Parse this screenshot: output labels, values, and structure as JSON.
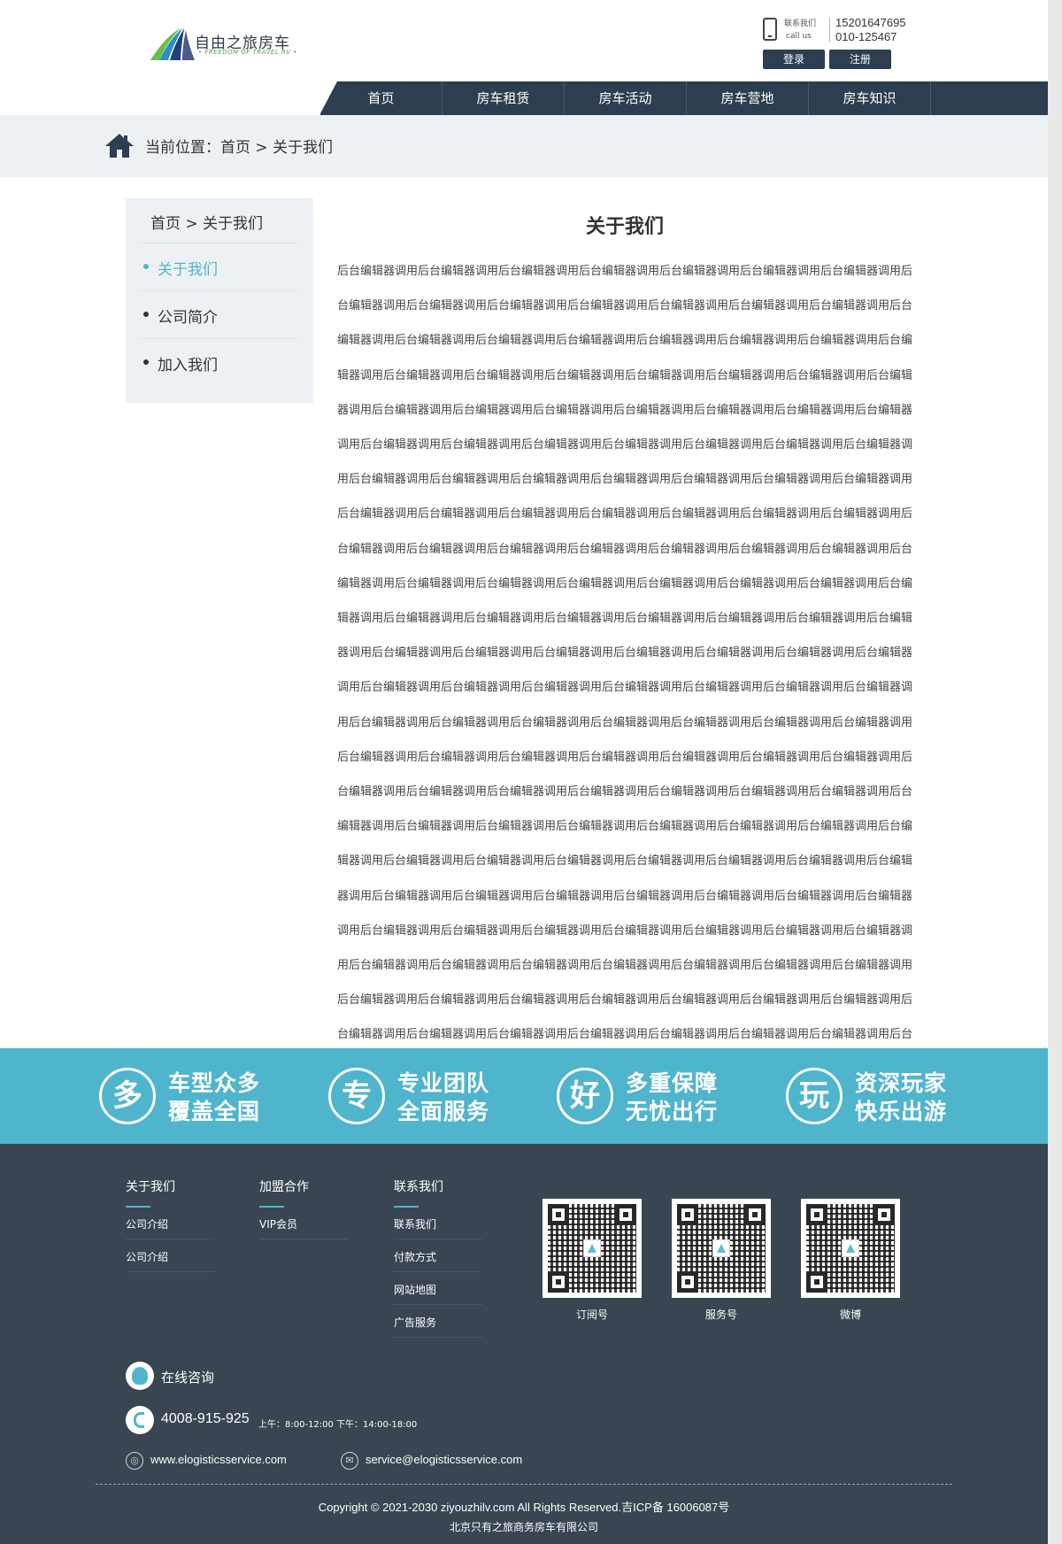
{
  "header": {
    "logo_title": "自由之旅房车",
    "logo_subtitle": "• FREEDOM OF TRAVEL RV •",
    "contact_label_cn": "联系我们",
    "contact_label_en": "call us",
    "phone_1": "15201647695",
    "phone_2": "010-125467",
    "login_label": "登录",
    "register_label": "注册"
  },
  "nav": {
    "items": [
      {
        "label": "首页"
      },
      {
        "label": "房车租赁"
      },
      {
        "label": "房车活动"
      },
      {
        "label": "房车营地"
      },
      {
        "label": "房车知识"
      }
    ]
  },
  "breadcrumb": {
    "text": "当前位置：首页 > 关于我们"
  },
  "sidebar": {
    "title": "首页 > 关于我们",
    "items": [
      {
        "label": "关于我们",
        "active": true
      },
      {
        "label": "公司简介",
        "active": false
      },
      {
        "label": "加入我们",
        "active": false
      }
    ]
  },
  "article": {
    "title": "关于我们",
    "body": "后台编辑器调用后台编辑器调用后台编辑器调用后台编辑器调用后台编辑器调用后台编辑器调用后台编辑器调用后台编辑器调用后台编辑器调用后台编辑器调用后台编辑器调用后台编辑器调用后台编辑器调用后台编辑器调用后台编辑器调用后台编辑器调用后台编辑器调用后台编辑器调用后台编辑器调用后台编辑器调用后台编辑器调用后台编辑器调用后台编辑器调用后台编辑器调用后台编辑器调用后台编辑器调用后台编辑器调用后台编辑器调用后台编辑器调用后台编辑器调用后台编辑器调用后台编辑器调用后台编辑器调用后台编辑器调用后台编辑器调用后台编辑器调用后台编辑器调用后台编辑器调用后台编辑器调用后台编辑器调用后台编辑器调用后台编辑器调用后台编辑器调用后台编辑器调用后台编辑器调用后台编辑器调用后台编辑器调用后台编辑器调用后台编辑器调用后台编辑器调用后台编辑器调用后台编辑器调用后台编辑器调用后台编辑器调用后台编辑器调用后台编辑器调用后台编辑器调用后台编辑器调用后台编辑器调用后台编辑器调用后台编辑器调用后台编辑器调用后台编辑器调用后台编辑器调用后台编辑器调用后台编辑器调用后台编辑器调用后台编辑器调用后台编辑器调用后台编辑器调用后台编辑器调用后台编辑器调用后台编辑器调用后台编辑器调用后台编辑器调用后台编辑器调用后台编辑器调用后台编辑器调用后台编辑器调用后台编辑器调用后台编辑器调用后台编辑器调用后台编辑器调用后台编辑器调用后台编辑器调用后台编辑器调用后台编辑器调用后台编辑器调用后台编辑器调用后台编辑器调用后台编辑器调用后台编辑器调用后台编辑器调用后台编辑器调用后台编辑器调用后台编辑器调用后台编辑器调用后台编辑器调用后台编辑器调用后台编辑器调用后台编辑器调用后台编辑器调用后台编辑器调用后台编辑器调用后台编辑器调用后台编辑器调用后台编辑器调用后台编辑器调用后台编辑器调用后台编辑器调用后台编辑器调用后台编辑器调用后台编辑器调用后台编辑器调用后台编辑器调用后台编辑器调用后台编辑器调用后台编辑器调用后台编辑器调用后台编辑器调用后台编辑器调用后台编辑器调用后台编辑器调用后台编辑器调用后台编辑器调用后台编辑器调用后台编辑器调用后台编辑器调用后台编辑器调用后台编辑器调用后台编辑器调用后台编辑器调用后台编辑器调用后台编辑器调用后台编辑器调用后台编辑器调用后台编辑器调用后台编辑器调用后台编辑器调用后台编辑器调用后台编辑器调用后台编辑器调用后台编辑器调用后台编辑器调用后台编辑器调用后台编辑器调用后台编辑器调用后台编辑器调用后台编辑器调用后台编辑器调用后台编辑器调用后台编辑器调用后台编辑器调用后台编辑器调用后台编辑器调用后台编辑器调用后台编辑器调用后台编辑器调用后台编辑器调用后台编辑器调用后台编辑器调用后台编辑器调用后台编辑器调用后台编辑器调用后台编辑器调用后台编辑器调用后台编辑器调用后台编辑器调用后台编辑器调用"
  },
  "features": [
    {
      "glyph": "多",
      "line1": "车型众多",
      "line2": "覆盖全国"
    },
    {
      "glyph": "专",
      "line1": "专业团队",
      "line2": "全面服务"
    },
    {
      "glyph": "好",
      "line1": "多重保障",
      "line2": "无忧出行"
    },
    {
      "glyph": "玩",
      "line1": "资深玩家",
      "line2": "快乐出游"
    }
  ],
  "footer": {
    "columns": [
      {
        "title": "关于我们",
        "links": [
          "公司介绍",
          "公司介绍"
        ]
      },
      {
        "title": "加盟合作",
        "links": [
          "VIP会员"
        ]
      },
      {
        "title": "联系我们",
        "links": [
          "联系我们",
          "付款方式",
          "网站地图",
          "广告服务"
        ]
      }
    ],
    "qr_codes": [
      {
        "label": "订阅号"
      },
      {
        "label": "服务号"
      },
      {
        "label": "微博"
      }
    ],
    "consult_label": "在线咨询",
    "hotline": "4008-915-925",
    "hours_am": "上午：8:00-12:00",
    "hours_pm": "下午：14:00-18:00",
    "website": "www.elogisticsservice.com",
    "email": "service@elogisticsservice.com",
    "copyright": "Copyright © 2021-2030 ziyouzhilv.com All Rights Reserved.吉ICP备 16006087号",
    "company": "北京只有之旅商务房车有限公司"
  },
  "colors": {
    "accent": "#4fb5cc",
    "nav_bg": "#2c3e50",
    "footer_bg": "#394550",
    "crumb_bg": "#eef1f4"
  }
}
